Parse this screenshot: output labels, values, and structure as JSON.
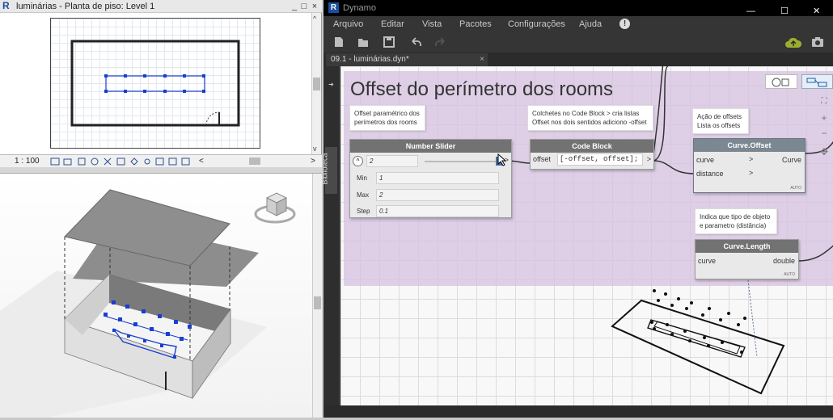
{
  "revit": {
    "plan_window_title": "luminárias - Planta de piso: Level 1",
    "window_controls": {
      "minimize": "_",
      "restore": "□",
      "close": "×"
    },
    "scale": "1 : 100",
    "scroll_up": "^",
    "scroll_down": "v",
    "scroll_left": "<",
    "scroll_right": ">"
  },
  "dynamo": {
    "app_title": "Dynamo",
    "window_controls": {
      "minimize": "—",
      "maximize": "☐",
      "close": "✕"
    },
    "menu": [
      "Arquivo",
      "Editar",
      "Vista",
      "Pacotes",
      "Configurações",
      "Ajuda"
    ],
    "help_badge": "!",
    "tab_name": "09.1 - luminárias.dyn*",
    "tab_close": "×",
    "library_label": "Biblioteca",
    "zoom": {
      "fit": "⛶",
      "in": "+",
      "out": "−",
      "pan": "✥"
    },
    "group_title": "Offset do perímetro dos rooms",
    "notes": [
      {
        "text": "Offset paramétrico dos perímetros dos rooms"
      },
      {
        "text": "Colchetes no Code Block > cria listas Offset nos dois sentidos adiciono -offset"
      },
      {
        "text": "Ação de offsets Lista os offsets"
      },
      {
        "text": "Indica que tipo de objeto e parametro (distância)"
      }
    ],
    "number_slider": {
      "title": "Number Slider",
      "value": "2",
      "out": ">",
      "min_label": "Min",
      "min": "1",
      "max_label": "Max",
      "max": "2",
      "step_label": "Step",
      "step": "0.1"
    },
    "code_block": {
      "title": "Code Block",
      "port": "offset",
      "code": "[-offset, offset];",
      "out": ">"
    },
    "curve_offset": {
      "title": "Curve.Offset",
      "in1": "curve",
      "in2": "distance",
      "out": "Curve",
      "lacing": "AUTO"
    },
    "curve_length": {
      "title": "Curve.Length",
      "in1": "curve",
      "out": "double",
      "lacing": "AUTO"
    }
  },
  "colors": {
    "dynamo_bg": "#232323",
    "group_fill": "#d5c1e0",
    "node_header": "#727272",
    "revit_blue": "#1b4fa0"
  }
}
